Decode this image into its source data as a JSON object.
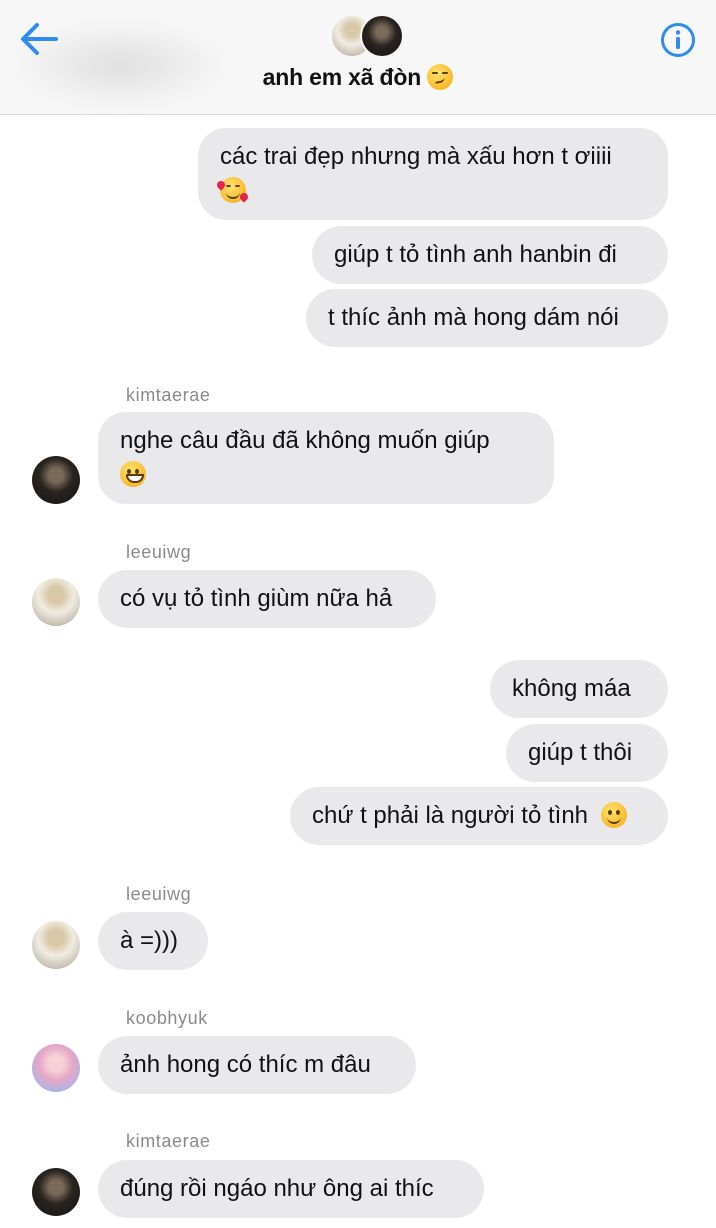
{
  "header": {
    "title": "anh em xã đòn",
    "title_emoji": "smirking-face-emoji"
  },
  "messages": [
    {
      "id": "o1",
      "side": "outgoing",
      "lines": [
        "các trai đẹp nhưng mà xấu hơn t ơiiii"
      ],
      "emoji": "smiling-face-with-hearts-emoji"
    },
    {
      "id": "o2",
      "side": "outgoing",
      "lines": [
        "giúp t tỏ tình anh hanbin đi"
      ]
    },
    {
      "id": "o3",
      "side": "outgoing",
      "lines": [
        "t thíc ảnh mà hong dám nói"
      ]
    },
    {
      "id": "i1",
      "side": "incoming",
      "sender": "kimtaerae",
      "lines": [
        "nghe câu đầu đã không muốn giúp"
      ],
      "emoji": "grinning-face-emoji"
    },
    {
      "id": "i2",
      "side": "incoming",
      "sender": "leeuiwg",
      "lines": [
        "có vụ tỏ tình giùm nữa hả"
      ]
    },
    {
      "id": "o4",
      "side": "outgoing",
      "lines": [
        "không máa"
      ]
    },
    {
      "id": "o5",
      "side": "outgoing",
      "lines": [
        "giúp t thôi"
      ]
    },
    {
      "id": "o6",
      "side": "outgoing",
      "lines": [
        "chứ t phải là người tỏ tình"
      ],
      "emoji": "slightly-smiling-face-emoji"
    },
    {
      "id": "i3",
      "side": "incoming",
      "sender": "leeuiwg",
      "lines": [
        "à =)))"
      ]
    },
    {
      "id": "i4",
      "side": "incoming",
      "sender": "koobhyuk",
      "lines": [
        "ảnh hong có thíc m đâu"
      ]
    },
    {
      "id": "i5",
      "side": "incoming",
      "sender": "kimtaerae",
      "lines": [
        "đúng rồi ngáo như ông ai thíc"
      ]
    }
  ],
  "colors": {
    "accent": "#2e8bf0",
    "bubble": "#e9e9eb",
    "sender_name": "#8a8a8e",
    "header_bg": "#f7f7f7"
  },
  "icons": [
    "back-arrow-icon",
    "info-icon"
  ]
}
